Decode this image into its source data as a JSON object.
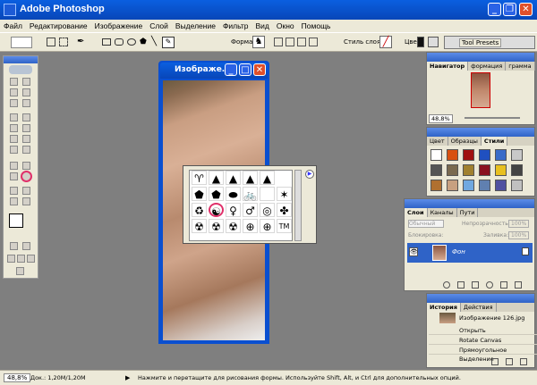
{
  "app": {
    "title": "Adobe Photoshop"
  },
  "menu": [
    "Файл",
    "Редактирование",
    "Изображение",
    "Слой",
    "Выделение",
    "Фильтр",
    "Вид",
    "Окно",
    "Помощь"
  ],
  "options": {
    "shape_label": "Форма:",
    "style_label": "Стиль слоя:",
    "color_label": "Цвет:",
    "tool_presets": "Tool Presets"
  },
  "doc": {
    "title": "Изображе..."
  },
  "navigator": {
    "tabs": [
      "Навигатор",
      "формация",
      "грамма"
    ],
    "zoom": "48,8%"
  },
  "swatches": {
    "tabs": [
      "Цвет",
      "Образцы",
      "Стили"
    ]
  },
  "layers": {
    "tabs": [
      "Слои",
      "Каналы",
      "Пути"
    ],
    "blend": "Обычный",
    "opacity_label": "Непрозрачность:",
    "opacity": "100%",
    "lock_label": "Блокировка:",
    "fill_label": "Заливка:",
    "fill": "100%",
    "layer_name": "Фон"
  },
  "history": {
    "tabs": [
      "История",
      "Действия"
    ],
    "snapshot": "Изображение 126.jpg",
    "items": [
      "Открыть",
      "Rotate Canvas",
      "Прямоугольное Выделение"
    ]
  },
  "status": {
    "zoom": "48,8%",
    "doc_size": "Док.: 1,20M/1,20M",
    "hint": "Нажмите и перетащите для рисования формы. Используйте Shift, Alt, и Ctrl для дополнительных опций."
  },
  "shapes_picker": {
    "glyphs": [
      "♈",
      "▲",
      "▲",
      "▲",
      "▲",
      "⬟",
      "⬟",
      "⬬",
      "🚲",
      "",
      "♻",
      "☯",
      "♀",
      "♂",
      "◎",
      "✤",
      "☢",
      "☢",
      "☢",
      "✶",
      "⊕",
      "⊕",
      "TM",
      "▭",
      "▤"
    ]
  }
}
